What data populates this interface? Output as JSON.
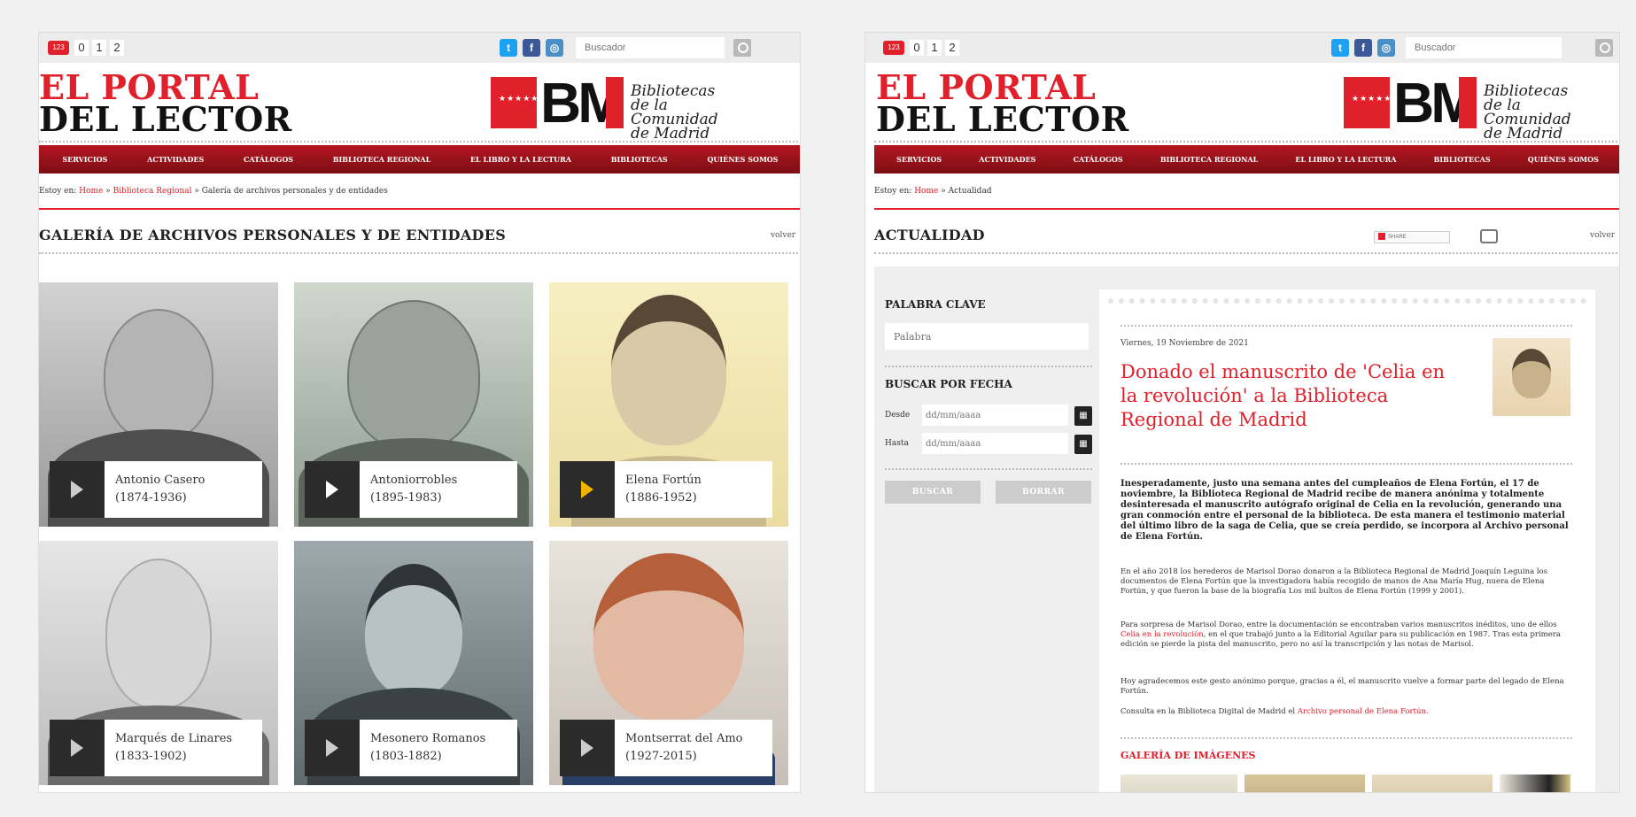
{
  "top": {
    "version_badge": "123",
    "pages": [
      "0",
      "1",
      "2"
    ],
    "social": [
      "twitter",
      "facebook",
      "instagram"
    ],
    "search_placeholder": "Buscador"
  },
  "brand": {
    "line1": "EL PORTAL",
    "line2": "DEL LECTOR"
  },
  "logo": {
    "flag_text": "★★★★★★★",
    "letters": "BM",
    "left_text": [
      "Bibliotecas",
      "de la Comunidad",
      "de Madrid"
    ],
    "right_text": [
      "Bibliotecas",
      "de la Comunidad",
      "de Madrid"
    ]
  },
  "nav": [
    "SERVICIOS",
    "ACTIVIDADES",
    "CATÁLOGOS",
    "BIBLIOTECA REGIONAL",
    "EL LIBRO Y LA LECTURA",
    "BIBLIOTECAS",
    "QUIÉNES SOMOS"
  ],
  "left": {
    "breadcrumb_prefix": "Estoy en:",
    "breadcrumb_home": "Home",
    "breadcrumb_sep": "»",
    "breadcrumb_mid": "Biblioteca Regional",
    "breadcrumb_current": "Galería de archivos personales y de entidades",
    "title": "GALERÍA DE ARCHIVOS PERSONALES Y DE ENTIDADES",
    "volver": "volver",
    "cards": [
      {
        "name": "Antonio Casero",
        "years": "(1874-1936)"
      },
      {
        "name": "Antoniorrobles",
        "years": "(1895-1983)"
      },
      {
        "name": "Elena Fortún",
        "years": "(1886-1952)"
      },
      {
        "name": "Marqués de Linares",
        "years": "(1833-1902)"
      },
      {
        "name": "Mesonero Romanos",
        "years": "(1803-1882)"
      },
      {
        "name": "Montserrat del Amo",
        "years": "(1927-2015)"
      }
    ]
  },
  "right": {
    "breadcrumb_prefix": "Estoy en:",
    "breadcrumb_home": "Home",
    "breadcrumb_sep": "»",
    "breadcrumb_current": "Actualidad",
    "title": "ACTUALIDAD",
    "volver": "volver",
    "share_label": "SHARE",
    "sidebar": {
      "keyword_heading": "PALABRA CLAVE",
      "keyword_placeholder": "Palabra",
      "date_heading": "BUSCAR POR FECHA",
      "from_label": "Desde",
      "to_label": "Hasta",
      "date_placeholder": "dd/mm/aaaa",
      "search_btn": "BUSCAR",
      "clear_btn": "BORRAR"
    },
    "article": {
      "date": "Viernes, 19 Noviembre de 2021",
      "title": "Donado el manuscrito de 'Celia en la revolución' a la Biblioteca Regional de Madrid",
      "lead": "Inesperadamente, justo una semana antes del cumpleaños de Elena Fortún, el 17 de noviembre, la Biblioteca Regional de Madrid recibe de manera anónima y totalmente desinteresada el manuscrito autógrafo original de Celia en la revolución, generando una gran conmoción entre el personal de la biblioteca. De esta manera el testimonio material del último libro de la saga de Celia, que se creía perdido, se incorpora al Archivo personal de Elena Fortún.",
      "p1": "En el año 2018 los herederos de Marisol Dorao donaron a la Biblioteca Regional de Madrid Joaquín Leguina los documentos de Elena Fortún que la investigadora había recogido de manos de Ana María Hug, nuera de Elena Fortún, y que fueron la base de la biografía Los mil bultos de Elena Fortún (1999 y 2001).",
      "p2_a": "Para sorpresa de Marisol Dorao, entre la documentación se encontraban varios manuscritos inéditos, uno de ellos ",
      "p2_link": "Celia en la revolución",
      "p2_b": ", en el que trabajó junto a la Editorial Aguilar para su publicación en 1987. Tras esta primera edición se pierde la pista del manuscrito, pero no así la transcripción y las notas de Marisol.",
      "p3": "Hoy agradecemos este gesto anónimo porque, gracias a él, el manuscrito vuelve a formar parte del legado de Elena Fortún.",
      "p4_a": "Consulta en la Biblioteca Digital de Madrid el ",
      "p4_link": "Archivo personal de Elena Fortún",
      "p4_b": ".",
      "gallery_heading": "GALERÍA DE IMÁGENES"
    }
  }
}
